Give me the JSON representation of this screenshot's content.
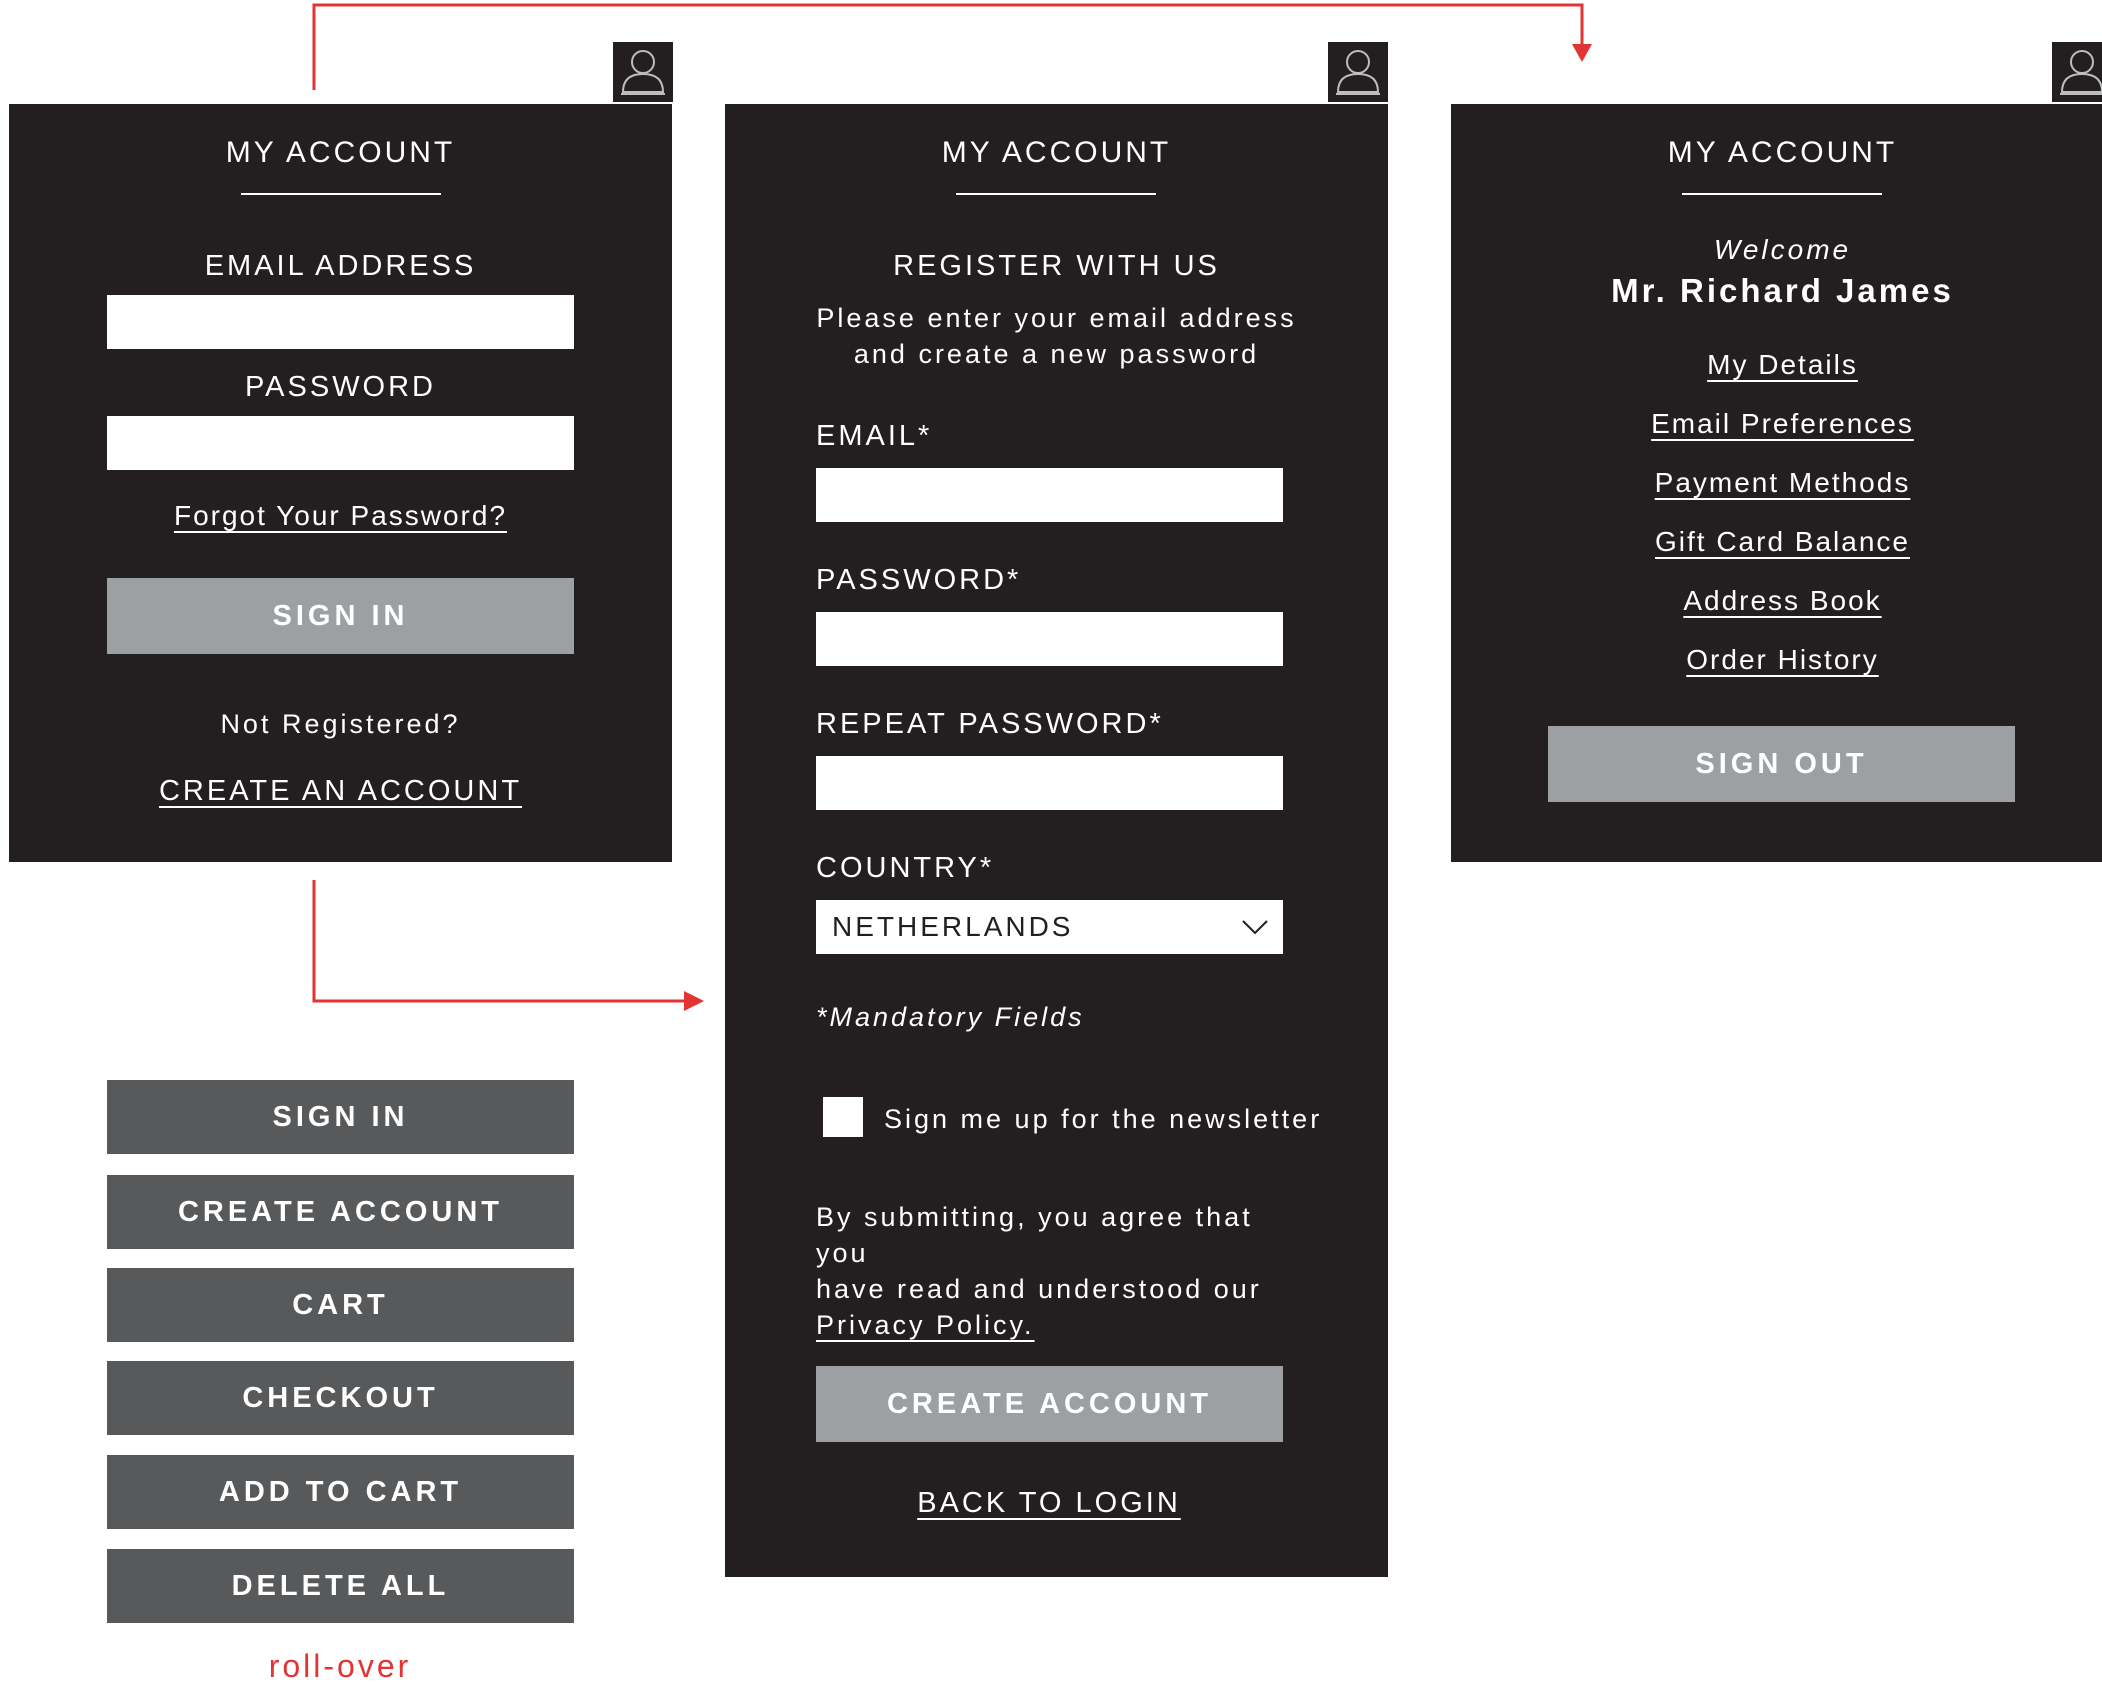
{
  "signin_panel": {
    "title": "MY ACCOUNT",
    "email_label": "EMAIL ADDRESS",
    "email_value": "",
    "password_label": "PASSWORD",
    "password_value": "",
    "forgot_link": "Forgot Your Password?",
    "sign_in_button": "SIGN IN",
    "not_registered": "Not Registered?",
    "create_link": "CREATE AN ACCOUNT"
  },
  "register_panel": {
    "title": "MY ACCOUNT",
    "heading": "REGISTER WITH US",
    "intro_line1": "Please enter your email address",
    "intro_line2": "and create a new password",
    "email_label": "EMAIL*",
    "email_value": "",
    "password_label": "PASSWORD*",
    "password_value": "",
    "repeat_label": "REPEAT PASSWORD*",
    "repeat_value": "",
    "country_label": "COUNTRY*",
    "country_value": "NETHERLANDS",
    "mandatory_note": "*Mandatory Fields",
    "newsletter_label": "Sign me up for the newsletter",
    "newsletter_checked": false,
    "agree_line1": "By submitting, you agree that you",
    "agree_line2": "have read and understood our",
    "privacy_link": "Privacy Policy.",
    "create_button": "CREATE ACCOUNT",
    "back_link": "BACK TO LOGIN"
  },
  "account_panel": {
    "title": "MY ACCOUNT",
    "welcome": "Welcome",
    "user_name": "Mr. Richard James",
    "links": [
      {
        "label": "My Details"
      },
      {
        "label": "Email Preferences"
      },
      {
        "label": "Payment Methods"
      },
      {
        "label": "Gift Card Balance"
      },
      {
        "label": "Address Book"
      },
      {
        "label": "Order History"
      }
    ],
    "sign_out_button": "SIGN OUT"
  },
  "rollover_buttons": [
    {
      "label": "SIGN IN"
    },
    {
      "label": "CREATE ACCOUNT"
    },
    {
      "label": "CART"
    },
    {
      "label": "CHECKOUT"
    },
    {
      "label": "ADD TO CART"
    },
    {
      "label": "DELETE ALL"
    }
  ],
  "rollover_caption": "roll-over",
  "icons": {
    "user_tab": "user-icon",
    "country_dropdown": "chevron-down-icon"
  },
  "colors": {
    "panel": "#231f20",
    "button_light": "#9da0a2",
    "button_dark": "#58595b",
    "flow_arrow": "#e33434",
    "text": "#ffffff"
  }
}
